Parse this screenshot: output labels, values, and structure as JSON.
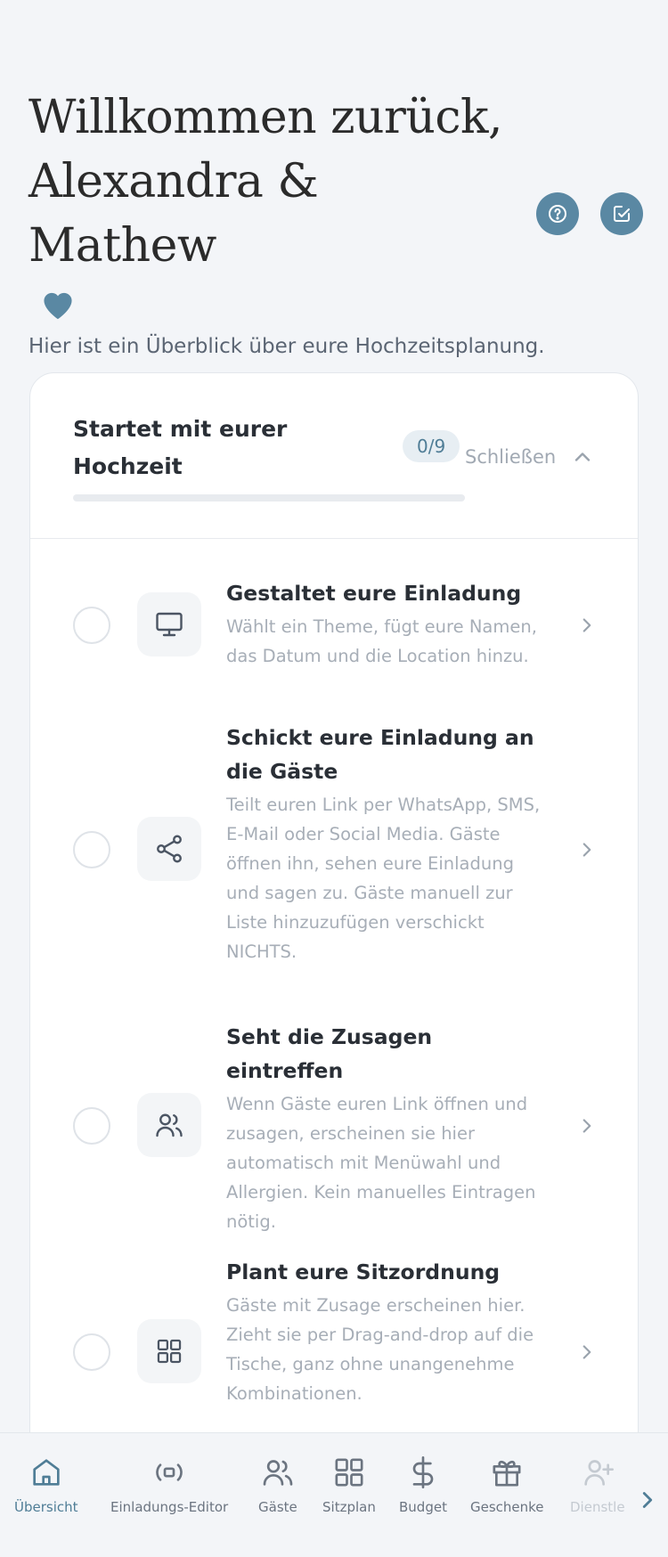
{
  "header": {
    "title_line1": "Willkommen zurück,",
    "title_line2": "Alexandra & Mathew",
    "subtitle": "Hier ist ein Überblick über eure Hochzeitsplanung."
  },
  "checklist": {
    "title": "Startet mit eurer Hochzeit",
    "count": "0/9",
    "progress": 0,
    "close_label": "Schließen",
    "tasks": [
      {
        "title": "Gestaltet eure Einladung",
        "desc": "Wählt ein Theme, fügt eure Namen, das Datum und die Location hinzu.",
        "icon": "monitor-icon"
      },
      {
        "title": "Schickt eure Einladung an die Gäste",
        "desc": "Teilt euren Link per WhatsApp, SMS, E-Mail oder Social Media. Gäste öffnen ihn, sehen eure Einladung und sagen zu. Gäste manuell zur Liste hinzuzufügen verschickt NICHTS.",
        "icon": "share-icon"
      },
      {
        "title": "Seht die Zusagen eintreffen",
        "desc": "Wenn Gäste euren Link öffnen und zusagen, erscheinen sie hier automatisch mit Menüwahl und Allergien. Kein manuelles Eintragen nötig.",
        "icon": "users-icon"
      },
      {
        "title": "Plant eure Sitzordnung",
        "desc": "Gäste mit Zusage erscheinen hier. Zieht sie per Drag-and-drop auf die Tische, ganz ohne unangenehme Kombinationen.",
        "icon": "grid-icon"
      }
    ]
  },
  "nav": {
    "items": [
      {
        "label": "Übersicht",
        "icon": "home-icon"
      },
      {
        "label": "Einladungs-Editor",
        "icon": "broadcast-icon"
      },
      {
        "label": "Gäste",
        "icon": "users-icon"
      },
      {
        "label": "Sitzplan",
        "icon": "grid-icon"
      },
      {
        "label": "Budget",
        "icon": "dollar-icon"
      },
      {
        "label": "Geschenke",
        "icon": "gift-icon"
      },
      {
        "label": "Dienstle",
        "icon": "user-plus-icon"
      }
    ]
  },
  "colors": {
    "accent": "#5a88a3",
    "background": "#f3f5f8"
  }
}
